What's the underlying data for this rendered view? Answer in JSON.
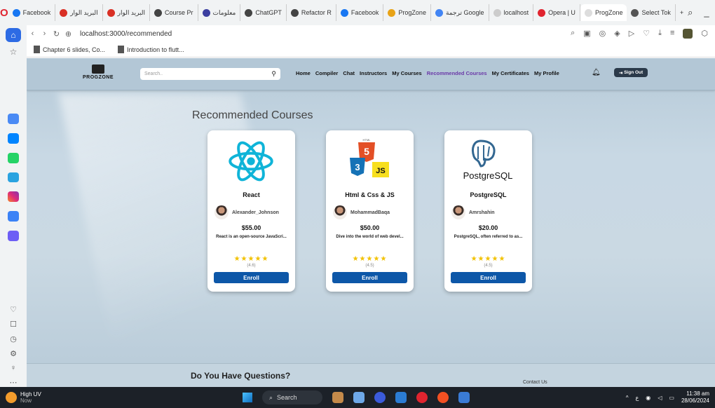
{
  "browser": {
    "tabs": [
      {
        "label": "Facebook",
        "color": "#1877f2"
      },
      {
        "label": "البريد الوار",
        "color": "#d93025"
      },
      {
        "label": "البريد الوار",
        "color": "#d93025"
      },
      {
        "label": "Course Pr",
        "color": "#444444"
      },
      {
        "label": "معلومات",
        "color": "#3c3fa0"
      },
      {
        "label": "ChatGPT",
        "color": "#444444"
      },
      {
        "label": "Refactor R",
        "color": "#444444"
      },
      {
        "label": "Facebook",
        "color": "#1877f2"
      },
      {
        "label": "ProgZone",
        "color": "#e8a317"
      },
      {
        "label": "ترجمة Google",
        "color": "#4285f4"
      },
      {
        "label": "localhost",
        "color": "#cccccc"
      },
      {
        "label": "Opera | U",
        "color": "#e0242f"
      },
      {
        "label": "ProgZone",
        "color": "#dddddd"
      },
      {
        "label": "Select Tok",
        "color": "#555555"
      }
    ],
    "active_tab_index": 12,
    "url": "localhost:3000/recommended",
    "bookmarks": [
      "Chapter 6 slides, Co...",
      "Introduction to flutt..."
    ]
  },
  "site": {
    "logo_text": "PROGZONE",
    "search_placeholder": "Search..",
    "nav": [
      "Home",
      "Compiler",
      "Chat",
      "Instructors",
      "My Courses",
      "Recommended Courses",
      "My Certificates",
      "My Profile"
    ],
    "active_nav": "Recommended Courses",
    "sign_out": "Sign Out",
    "page_title": "Recommended Courses",
    "courses": [
      {
        "name": "React",
        "author": "Alexander_Johnson",
        "price": "$55.00",
        "desc": "React is an open-source JavaScri...",
        "stars": "★★★★★",
        "rating": "(4.6)",
        "enroll": "Enroll",
        "icon": "react-logo"
      },
      {
        "name": "Html & Css & JS",
        "author": "MohammadBaqa",
        "price": "$50.00",
        "desc": "Dive into the world of web devel...",
        "stars": "★★★★★",
        "rating": "(4.5)",
        "enroll": "Enroll",
        "icon": "html-css-js-logo"
      },
      {
        "name": "PostgreSQL",
        "author": "Amrshahin",
        "price": "$20.00",
        "desc": "PostgreSQL, often referred to as...",
        "stars": "★★★★★",
        "rating": "(4.5)",
        "enroll": "Enroll",
        "icon": "postgresql-logo"
      }
    ],
    "logo_texts": {
      "html5": "HTML",
      "js": "JS",
      "postgres": "PostgreSQL"
    },
    "footer_heading": "Do You Have Questions?",
    "contact": "Contact Us"
  },
  "taskbar": {
    "weather_title": "High UV",
    "weather_sub": "Now",
    "search": "Search",
    "time": "11:38 am",
    "date": "28/06/2024",
    "lang": "ع"
  },
  "colors": {
    "accent_nav": "#6b3aa8",
    "enroll": "#0d57a8",
    "star": "#f2c100"
  }
}
